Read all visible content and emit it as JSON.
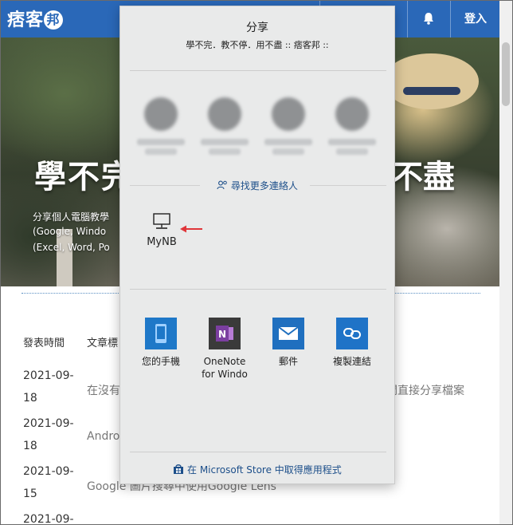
{
  "site": {
    "logo": "痞客",
    "logo_badge": "邦",
    "login": "登入",
    "hero_title_left": "學不完",
    "hero_title_right": "不盡",
    "hero_lines": [
      "分享個人電腦教學",
      "(Google, Windo",
      "(Excel, Word, Po"
    ]
  },
  "table": {
    "header_date": "發表時間",
    "header_title": "文章標",
    "rows": [
      {
        "date_line1": "2021-09-",
        "date_line2": "18",
        "title": "在沒有",
        "title_right": "間直接分享檔案"
      },
      {
        "date_line1": "2021-09-",
        "date_line2": "18",
        "title": "Andro",
        "title_right": ""
      },
      {
        "date_line1": "2021-09-",
        "date_line2": "15",
        "title": "Google 圖片搜尋中使用Google Lens",
        "title_right": ""
      },
      {
        "date_line1": "2021-09-",
        "date_line2": "",
        "title": "",
        "title_right": ""
      }
    ]
  },
  "share": {
    "title": "分享",
    "subtitle": "學不完．教不停．用不盡 :: 痞客邦 ::",
    "find_more": "尋找更多連絡人",
    "device_name": "MyNB",
    "apps": [
      {
        "label": "您的手機",
        "icon": "phone-icon",
        "color": "#1e78c8"
      },
      {
        "label": "OneNote for Windo",
        "icon": "onenote-icon",
        "color": "#7b3fa0"
      },
      {
        "label": "郵件",
        "icon": "mail-icon",
        "color": "#1f6fbf"
      },
      {
        "label": "複製連結",
        "icon": "link-icon",
        "color": "#1f73c7"
      }
    ],
    "store_text": "在 Microsoft Store 中取得應用程式"
  },
  "colors": {
    "header_blue": "#2a68b8",
    "link_blue": "#1d4f8a",
    "arrow_red": "#e0363a"
  }
}
